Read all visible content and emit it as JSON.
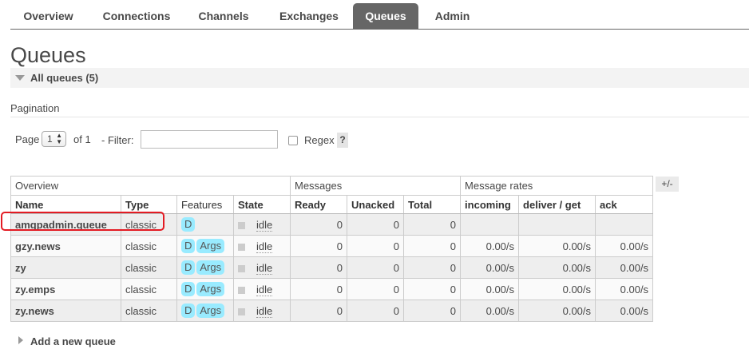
{
  "nav": {
    "tabs": [
      {
        "label": "Overview",
        "active": false
      },
      {
        "label": "Connections",
        "active": false
      },
      {
        "label": "Channels",
        "active": false
      },
      {
        "label": "Exchanges",
        "active": false
      },
      {
        "label": "Queues",
        "active": true
      },
      {
        "label": "Admin",
        "active": false
      }
    ]
  },
  "page_title": "Queues",
  "section": {
    "title": "All queues (5)",
    "icon": "triangle-down-icon"
  },
  "pagination": {
    "label": "Pagination",
    "page_label": "Page",
    "page_value": "1",
    "of_label": "of 1",
    "filter_label": "- Filter:",
    "filter_value": "",
    "regex_label": "Regex",
    "regex_checked": false,
    "help_label": "?"
  },
  "table": {
    "groups": [
      "Overview",
      "Messages",
      "Message rates"
    ],
    "columns": [
      "Name",
      "Type",
      "Features",
      "State",
      "Ready",
      "Unacked",
      "Total",
      "incoming",
      "deliver / get",
      "ack"
    ],
    "toggle_label": "+/-",
    "rows": [
      {
        "name": "amqpadmin.queue",
        "type": "classic",
        "features": [
          "D"
        ],
        "state": "idle",
        "ready": "0",
        "unacked": "0",
        "total": "0",
        "incoming": "",
        "deliver_get": "",
        "ack": ""
      },
      {
        "name": "gzy.news",
        "type": "classic",
        "features": [
          "D",
          "Args"
        ],
        "state": "idle",
        "ready": "0",
        "unacked": "0",
        "total": "0",
        "incoming": "0.00/s",
        "deliver_get": "0.00/s",
        "ack": "0.00/s"
      },
      {
        "name": "zy",
        "type": "classic",
        "features": [
          "D",
          "Args"
        ],
        "state": "idle",
        "ready": "0",
        "unacked": "0",
        "total": "0",
        "incoming": "0.00/s",
        "deliver_get": "0.00/s",
        "ack": "0.00/s"
      },
      {
        "name": "zy.emps",
        "type": "classic",
        "features": [
          "D",
          "Args"
        ],
        "state": "idle",
        "ready": "0",
        "unacked": "0",
        "total": "0",
        "incoming": "0.00/s",
        "deliver_get": "0.00/s",
        "ack": "0.00/s"
      },
      {
        "name": "zy.news",
        "type": "classic",
        "features": [
          "D",
          "Args"
        ],
        "state": "idle",
        "ready": "0",
        "unacked": "0",
        "total": "0",
        "incoming": "0.00/s",
        "deliver_get": "0.00/s",
        "ack": "0.00/s"
      }
    ]
  },
  "add_queue": {
    "label": "Add a new queue",
    "icon": "triangle-right-icon"
  },
  "colors": {
    "active_tab": "#666666",
    "badge": "#99ebff",
    "highlight": "#e31b23"
  }
}
